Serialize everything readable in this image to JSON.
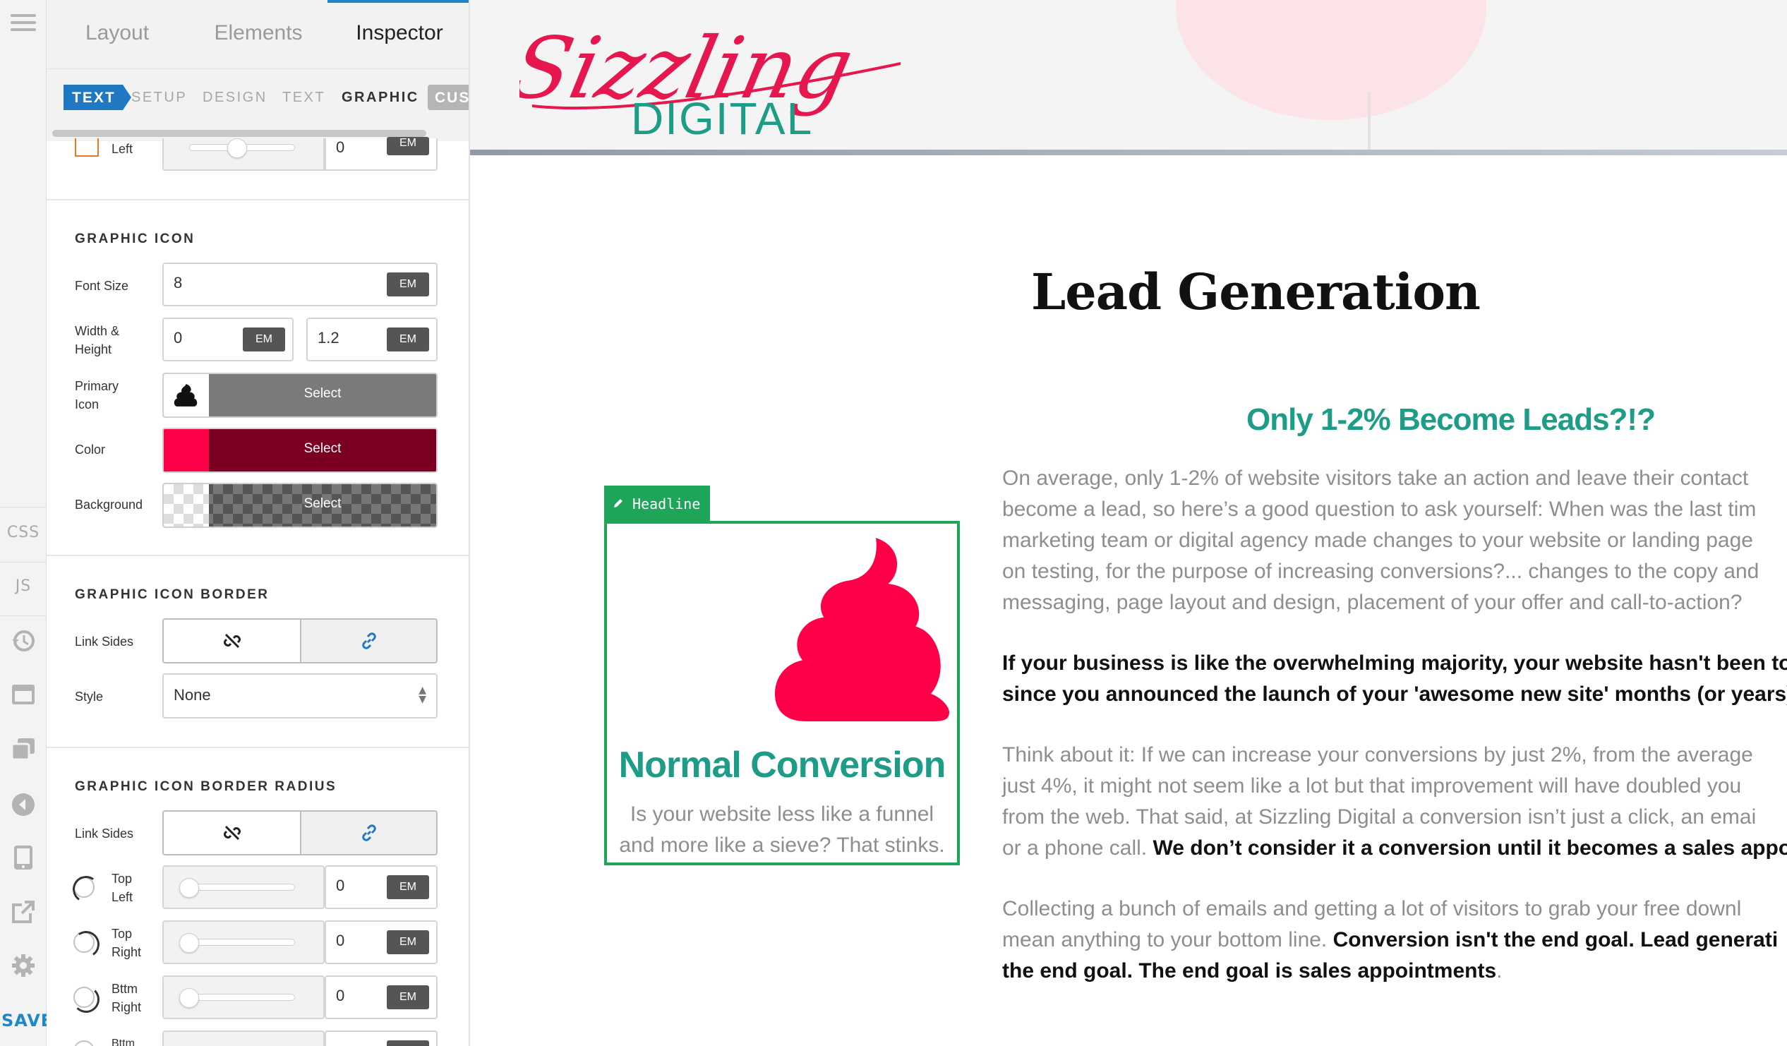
{
  "rail": {
    "css_label": "CSS",
    "js_label": "JS",
    "save_label": "SAVE"
  },
  "panel": {
    "tabs": [
      {
        "label": "Layout"
      },
      {
        "label": "Elements"
      },
      {
        "label": "Inspector",
        "active": true
      }
    ],
    "subtabs": {
      "crumb": "TEXT",
      "items": [
        "SETUP",
        "DESIGN",
        "TEXT",
        "GRAPHIC"
      ],
      "active": "GRAPHIC",
      "custom": "CUS"
    },
    "partial_row": {
      "label": "Left",
      "value": "0",
      "unit": "EM"
    },
    "graphic_icon": {
      "title": "GRAPHIC ICON",
      "font_size": {
        "label": "Font Size",
        "value": "8",
        "unit": "EM"
      },
      "width_height": {
        "label": "Width & Height",
        "width": "0",
        "height": "1.2",
        "unit": "EM"
      },
      "primary_icon": {
        "label": "Primary Icon",
        "button": "Select"
      },
      "color": {
        "label": "Color",
        "button": "Select",
        "value": "#ff0048"
      },
      "background": {
        "label": "Background",
        "button": "Select"
      }
    },
    "graphic_icon_border": {
      "title": "GRAPHIC ICON BORDER",
      "link_sides_label": "Link Sides",
      "style_label": "Style",
      "style_value": "None"
    },
    "graphic_icon_border_radius": {
      "title": "GRAPHIC ICON BORDER RADIUS",
      "link_sides_label": "Link Sides",
      "corners": [
        {
          "label": "Top Left",
          "value": "0",
          "unit": "EM"
        },
        {
          "label": "Top Right",
          "value": "0",
          "unit": "EM"
        },
        {
          "label": "Bttm Right",
          "value": "0",
          "unit": "EM"
        },
        {
          "label": "Bttm",
          "value": "",
          "unit": ""
        }
      ]
    }
  },
  "preview": {
    "logo": {
      "script": "Sizzling",
      "word": "DIGITAL"
    },
    "title": "Lead Generation",
    "subtitle": "Only 1-2% Become Leads?!?",
    "paragraph1": [
      "On average, only 1-2% of website visitors take an action and leave their contact",
      "become a lead, so here’s a good question to ask yourself: When was the last tim",
      "marketing team or digital agency made changes to your website or landing page",
      "on testing, for the purpose of increasing conversions?... changes to the copy and",
      "messaging, page layout and design, placement of your offer and call-to-action?"
    ],
    "paragraph2": [
      "If your business is like the overwhelming majority, your website hasn't been tou",
      "since you announced the launch of your 'awesome new site' months (or years) a"
    ],
    "paragraph3": [
      "Think about it: If we can increase your conversions by just 2%, from the average",
      "just 4%, it might not seem like a lot but that improvement will have doubled you",
      "from the web. That said, at Sizzling Digital a conversion isn’t just a click, an emai"
    ],
    "paragraph3_last_plain": "or a phone call. ",
    "paragraph3_last_bold": "We don’t consider it a conversion until it becomes a sales appoi",
    "paragraph4_line1": "Collecting a bunch of emails and getting a lot of visitors to grab your free downl",
    "paragraph4_line2_plain": "mean anything to your bottom line. ",
    "paragraph4_line2_bold": "Conversion isn't the end goal. Lead generati",
    "paragraph4_line3_bold": "the end goal. The end goal is sales appointments",
    "paragraph4_line3_tail": ".",
    "widget": {
      "tag": "Headline",
      "title": "Normal Conversion",
      "text_line1": "Is your website less like a funnel",
      "text_line2": "and more like a sieve? That stinks.",
      "icon_color": "#ff0048"
    }
  }
}
